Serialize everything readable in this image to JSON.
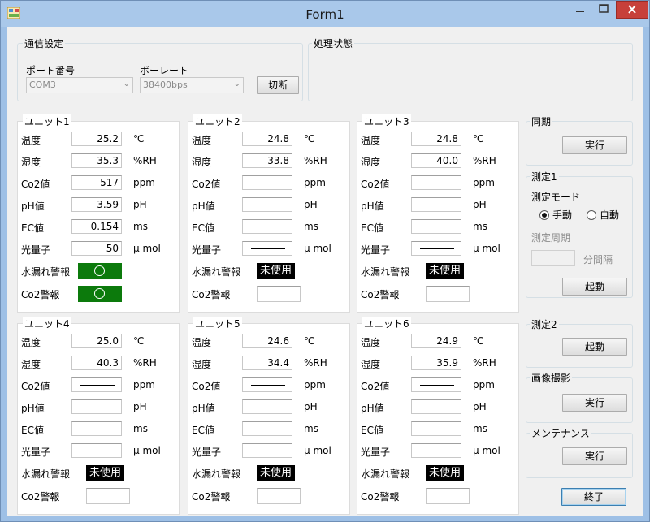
{
  "window": {
    "title": "Form1"
  },
  "comm": {
    "title": "通信設定",
    "port_label": "ポート番号",
    "port_value": "COM3",
    "baud_label": "ボーレート",
    "baud_value": "38400bps",
    "disconnect_label": "切断"
  },
  "status": {
    "title": "処理状態"
  },
  "units": [
    {
      "title": "ユニット1",
      "temp": "25.2",
      "humidity": "35.3",
      "co2": "517",
      "ph": "3.59",
      "ec": "0.154",
      "light": "50",
      "water_alarm": "ok",
      "co2_alarm": "ok"
    },
    {
      "title": "ユニット2",
      "temp": "24.8",
      "humidity": "33.8",
      "co2": "—",
      "ph": "",
      "ec": "",
      "light": "—",
      "water_alarm": "未使用",
      "co2_alarm": ""
    },
    {
      "title": "ユニット3",
      "temp": "24.8",
      "humidity": "40.0",
      "co2": "—",
      "ph": "",
      "ec": "",
      "light": "—",
      "water_alarm": "未使用",
      "co2_alarm": ""
    },
    {
      "title": "ユニット4",
      "temp": "25.0",
      "humidity": "40.3",
      "co2": "—",
      "ph": "",
      "ec": "",
      "light": "—",
      "water_alarm": "未使用",
      "co2_alarm": ""
    },
    {
      "title": "ユニット5",
      "temp": "24.6",
      "humidity": "34.4",
      "co2": "—",
      "ph": "",
      "ec": "",
      "light": "—",
      "water_alarm": "未使用",
      "co2_alarm": ""
    },
    {
      "title": "ユニット6",
      "temp": "24.9",
      "humidity": "35.9",
      "co2": "—",
      "ph": "",
      "ec": "",
      "light": "—",
      "water_alarm": "未使用",
      "co2_alarm": ""
    }
  ],
  "labels": {
    "temp": "温度",
    "humidity": "湿度",
    "co2": "Co2値",
    "ph": "pH値",
    "ec": "EC値",
    "light": "光量子",
    "water_alarm": "水漏れ警報",
    "co2_alarm": "Co2警報"
  },
  "units_text": {
    "temp": "℃",
    "humidity": "%RH",
    "co2": "ppm",
    "ph": "pH",
    "ec": "ms",
    "light": "μ mol"
  },
  "sync": {
    "title": "同期",
    "button": "実行"
  },
  "measure1": {
    "title": "測定1",
    "mode_label": "測定モード",
    "manual": "手動",
    "auto": "自動",
    "selected": "手動",
    "period_label": "測定周期",
    "interval_label": "分間隔",
    "button": "起動"
  },
  "measure2": {
    "title": "測定2",
    "button": "起動"
  },
  "image": {
    "title": "画像撮影",
    "button": "実行"
  },
  "maint": {
    "title": "メンテナンス",
    "button": "実行"
  },
  "exit_label": "終了",
  "colors": {
    "alarm_ok": "#0c7a0c",
    "alarm_unused": "#000000",
    "title_bar": "#a9c8ea",
    "close_button": "#c7403a"
  },
  "icons": [
    "app-icon",
    "minimize-icon",
    "maximize-icon",
    "close-icon",
    "dropdown-arrow-icon",
    "status-ok-circle-icon"
  ]
}
